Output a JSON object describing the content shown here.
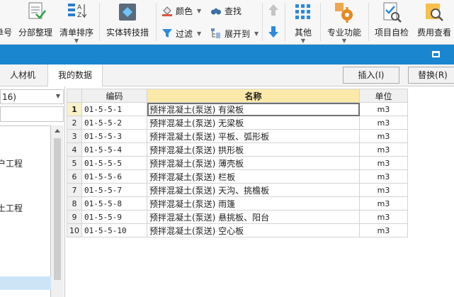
{
  "ribbon": {
    "btn_number": "单号",
    "btn_tidy": "分部整理",
    "btn_sort": "清单排序",
    "btn_convert": "实体转技措",
    "btn_color": "颜色",
    "btn_find": "查找",
    "btn_filter": "过滤",
    "btn_expand": "展开到",
    "btn_other": "其他",
    "btn_pro": "专业功能",
    "btn_check": "项目自检",
    "btn_fee": "费用查看"
  },
  "tabs": [
    {
      "label": "人材机"
    },
    {
      "label": "我的数据"
    }
  ],
  "actions": {
    "insert": "插入(I)",
    "replace": "替换(R)"
  },
  "left": {
    "combo_value": "16)",
    "tree": [
      "户工程",
      "土工程"
    ]
  },
  "table": {
    "headers": {
      "code": "编码",
      "name": "名称",
      "unit": "单位"
    },
    "rows": [
      {
        "no": "1",
        "code": "01-5-5-1",
        "name": "预拌混凝土(泵送) 有梁板",
        "unit": "m3"
      },
      {
        "no": "2",
        "code": "01-5-5-2",
        "name": "预拌混凝土(泵送) 无梁板",
        "unit": "m3"
      },
      {
        "no": "3",
        "code": "01-5-5-3",
        "name": "预拌混凝土(泵送) 平板、弧形板",
        "unit": "m3"
      },
      {
        "no": "4",
        "code": "01-5-5-4",
        "name": "预拌混凝土(泵送) 拱形板",
        "unit": "m3"
      },
      {
        "no": "5",
        "code": "01-5-5-5",
        "name": "预拌混凝土(泵送) 薄壳板",
        "unit": "m3"
      },
      {
        "no": "6",
        "code": "01-5-5-6",
        "name": "预拌混凝土(泵送) 栏板",
        "unit": "m3"
      },
      {
        "no": "7",
        "code": "01-5-5-7",
        "name": "预拌混凝土(泵送) 天沟、挑檐板",
        "unit": "m3"
      },
      {
        "no": "8",
        "code": "01-5-5-8",
        "name": "预拌混凝土(泵送) 雨篷",
        "unit": "m3"
      },
      {
        "no": "9",
        "code": "01-5-5-9",
        "name": "预拌混凝土(泵送) 悬挑板、阳台",
        "unit": "m3"
      },
      {
        "no": "10",
        "code": "01-5-5-10",
        "name": "预拌混凝土(泵送) 空心板",
        "unit": "m3"
      }
    ]
  }
}
